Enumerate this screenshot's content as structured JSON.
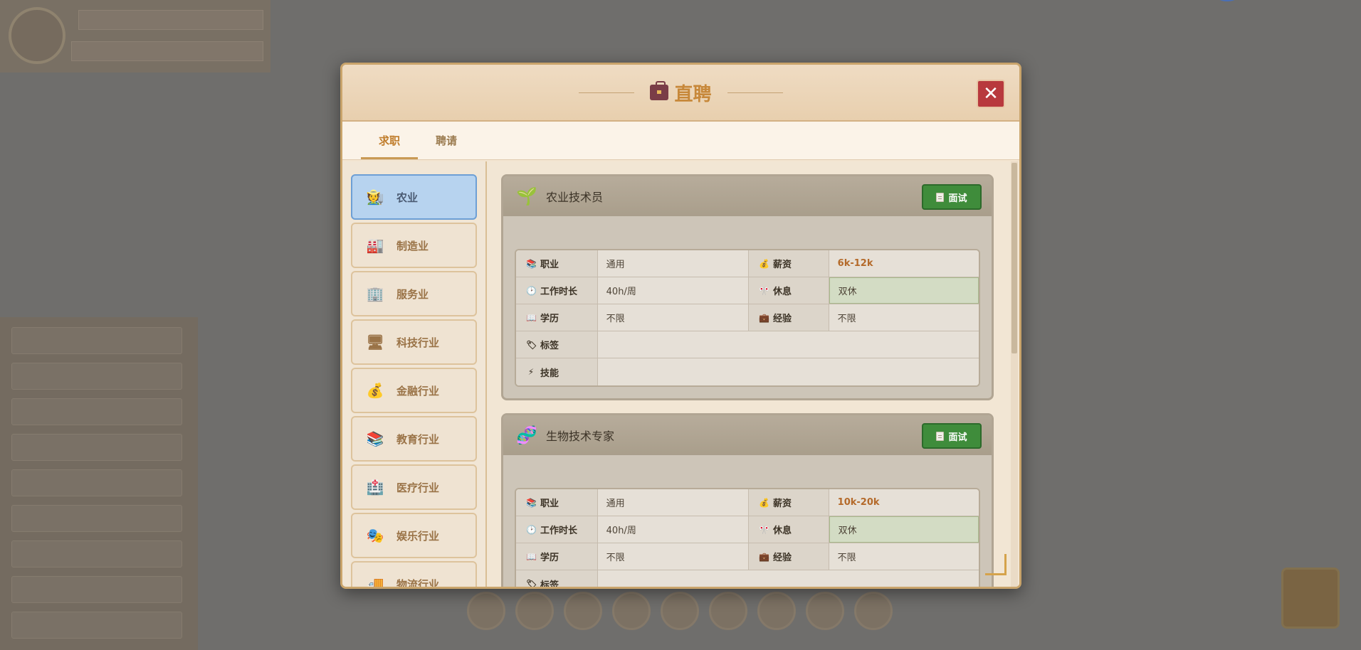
{
  "modal": {
    "title": "直聘",
    "close_symbol": "✕",
    "tabs": [
      {
        "label": "求职"
      },
      {
        "label": "聘请"
      }
    ]
  },
  "sidebar": {
    "items": [
      {
        "label": "农业",
        "icon": "farmer-icon",
        "glyph": "🧑‍🌾"
      },
      {
        "label": "制造业",
        "icon": "factory-icon",
        "glyph": "🏭"
      },
      {
        "label": "服务业",
        "icon": "building-icon",
        "glyph": "🏢"
      },
      {
        "label": "科技行业",
        "icon": "computer-icon",
        "glyph": "🖥"
      },
      {
        "label": "金融行业",
        "icon": "money-bag-icon",
        "glyph": "💰"
      },
      {
        "label": "教育行业",
        "icon": "books-icon",
        "glyph": "📚"
      },
      {
        "label": "医疗行业",
        "icon": "hospital-icon",
        "glyph": "🏥"
      },
      {
        "label": "娱乐行业",
        "icon": "theater-masks-icon",
        "glyph": "🎭"
      },
      {
        "label": "物流行业",
        "icon": "truck-icon",
        "glyph": "🚚"
      }
    ]
  },
  "labels": {
    "occupation": "职业",
    "salary": "薪资",
    "work_hours": "工作时长",
    "rest": "休息",
    "education": "学历",
    "experience": "经验",
    "tags": "标签",
    "skills": "技能",
    "interview": "面试"
  },
  "jobs": [
    {
      "title": "农业技术员",
      "icon": "seedling-icon",
      "glyph": "🌱",
      "occupation": "通用",
      "salary": "6k-12k",
      "work_hours": "40h/周",
      "rest": "双休",
      "education": "不限",
      "experience": "不限",
      "tags": "",
      "skills": ""
    },
    {
      "title": "生物技术专家",
      "icon": "dna-icon",
      "glyph": "🧬",
      "occupation": "通用",
      "salary": "10k-20k",
      "work_hours": "40h/周",
      "rest": "双休",
      "education": "不限",
      "experience": "不限",
      "tags": ""
    }
  ],
  "colors": {
    "accent": "#c7883a",
    "active_sidebar": "#b7d3ef",
    "interview_button": "#3f8c3b",
    "close_button": "#b8393d",
    "salary_text": "#b46a2a"
  }
}
